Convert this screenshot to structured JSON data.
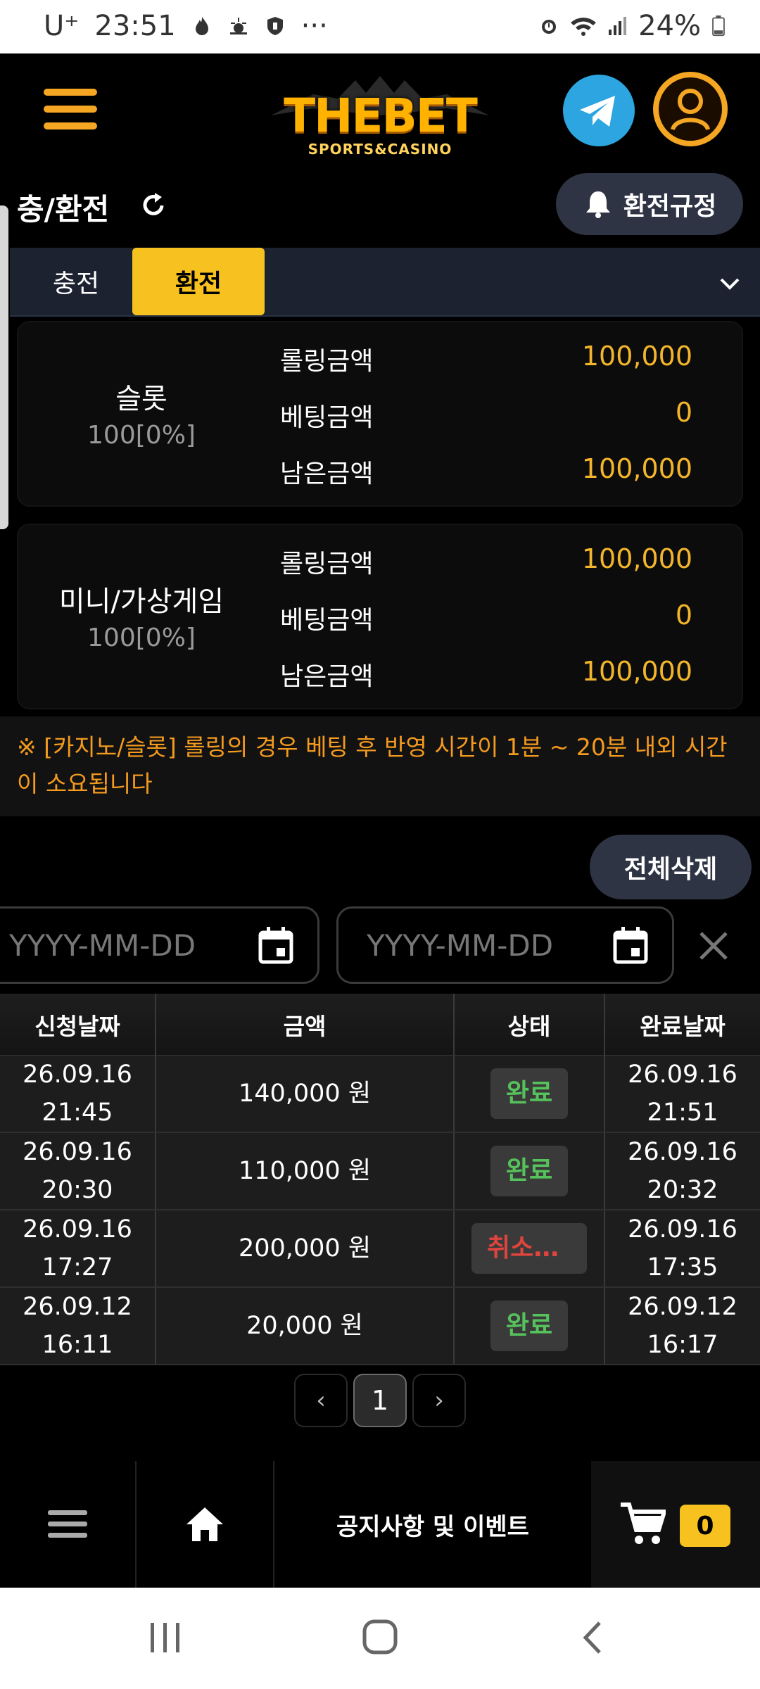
{
  "status_bar": {
    "carrier": "U⁺",
    "time": "23:51",
    "dots": "···",
    "battery": "24%"
  },
  "header": {
    "logo_text": "THEBET",
    "logo_sub": "SPORTS&CASINO"
  },
  "page": {
    "title": "충/환전",
    "rules_button": "환전규정"
  },
  "tabs": [
    {
      "label": "충전",
      "active": false
    },
    {
      "label": "환전",
      "active": true
    }
  ],
  "rolling_cards": [
    {
      "name": "슬롯",
      "percent": "100[0%]",
      "rows": [
        {
          "label": "롤링금액",
          "value": "100,000"
        },
        {
          "label": "베팅금액",
          "value": "0"
        },
        {
          "label": "남은금액",
          "value": "100,000"
        }
      ]
    },
    {
      "name": "미니/가상게임",
      "percent": "100[0%]",
      "rows": [
        {
          "label": "롤링금액",
          "value": "100,000"
        },
        {
          "label": "베팅금액",
          "value": "0"
        },
        {
          "label": "남은금액",
          "value": "100,000"
        }
      ]
    }
  ],
  "notice": {
    "line1": "※ [카지노/슬롯] 롤링의 경우 베팅 후 반영 시간이 1분 ~ 20분 내외 시간",
    "line2": "이 소요됩니다"
  },
  "history": {
    "delete_all": "전체삭제",
    "date_placeholder_start": "YYYY-MM-DD",
    "date_placeholder_end": "YYYY-MM-DD",
    "columns": [
      "신청날짜",
      "금액",
      "상태",
      "완료날짜"
    ],
    "rows": [
      {
        "req_date": "26.09.16",
        "req_time": "21:45",
        "amount": "140,000 원",
        "status": "완료",
        "done_date": "26.09.16",
        "done_time": "21:51"
      },
      {
        "req_date": "26.09.16",
        "req_time": "20:30",
        "amount": "110,000 원",
        "status": "완료",
        "done_date": "26.09.16",
        "done_time": "20:32"
      },
      {
        "req_date": "26.09.16",
        "req_time": "17:27",
        "amount": "200,000 원",
        "status": "취소…",
        "done_date": "26.09.16",
        "done_time": "17:35"
      },
      {
        "req_date": "26.09.12",
        "req_time": "16:11",
        "amount": "20,000 원",
        "status": "완료",
        "done_date": "26.09.12",
        "done_time": "16:17"
      }
    ]
  },
  "pagination": {
    "prev": "‹",
    "current": "1",
    "next": "›"
  },
  "bottom_nav": {
    "notice_label": "공지사항 및 이벤트",
    "cart_count": "0"
  },
  "colors": {
    "accent_yellow": "#f7c21f",
    "value_orange": "#f3b52b",
    "notice_orange": "#f39a1f",
    "status_done": "#55c25b",
    "status_cancel": "#e0443e",
    "telegram_blue": "#2ca5e0"
  },
  "icons": {
    "menu": "hamburger-icon",
    "telegram": "telegram-icon",
    "profile": "user-icon",
    "refresh": "refresh-icon",
    "bell": "bell-icon",
    "calendar": "calendar-icon",
    "clear": "close-icon",
    "home": "home-icon",
    "cart": "cart-icon"
  }
}
